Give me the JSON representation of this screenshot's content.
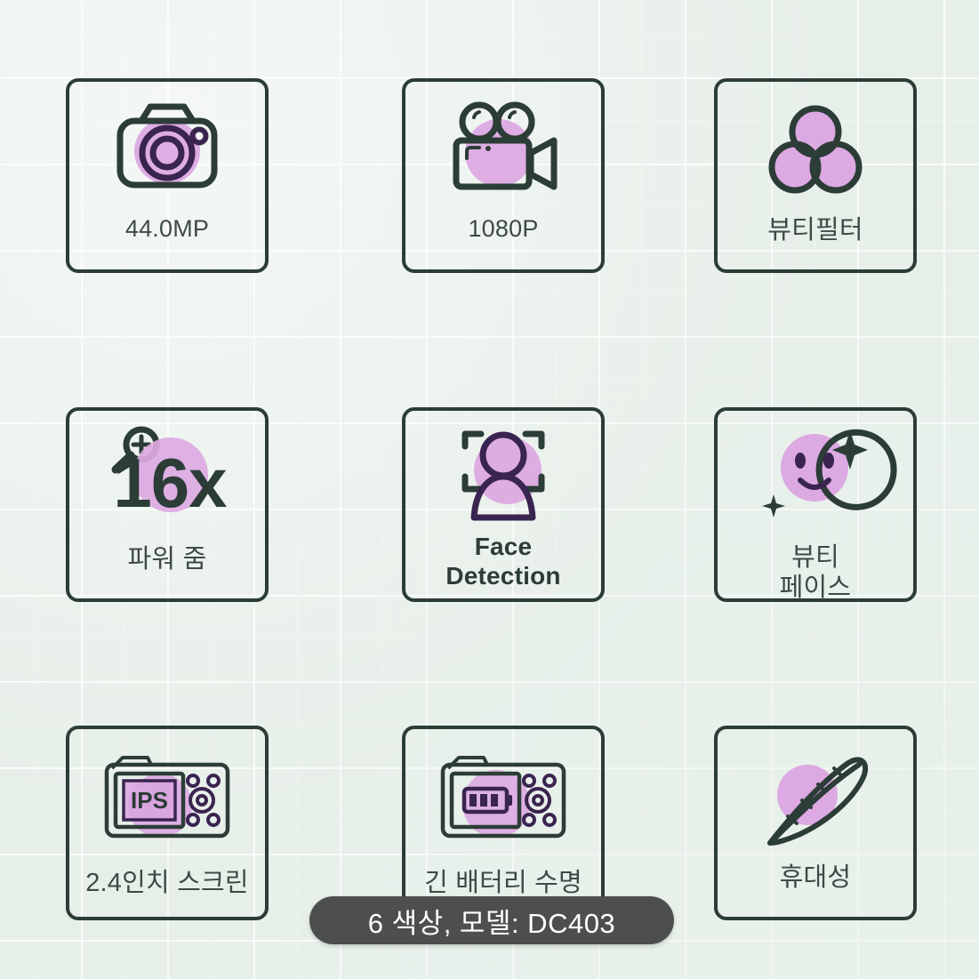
{
  "page": {
    "background_color": "#e7efe9",
    "tile_border_color": "#2c3c37",
    "accent_purple": "#dca9e2",
    "dark_purple": "#3a2450",
    "label_color": "#3d4a46"
  },
  "features": [
    {
      "id": "megapixels",
      "icon": "camera-icon",
      "label": "44.0MP"
    },
    {
      "id": "video",
      "icon": "camcorder-icon",
      "label": "1080P"
    },
    {
      "id": "beauty-filter",
      "icon": "color-circles-icon",
      "label": "뷰티필터"
    },
    {
      "id": "power-zoom",
      "icon": "magnifier-plus-icon",
      "label": "파워 줌",
      "value": "16x"
    },
    {
      "id": "face-detection",
      "icon": "face-frame-icon",
      "label": "Face\nDetection"
    },
    {
      "id": "beauty-face",
      "icon": "smiley-sparkle-icon",
      "label": "뷰티\n페이스"
    },
    {
      "id": "screen",
      "icon": "camera-back-ips-icon",
      "label": "2.4인치 스크린"
    },
    {
      "id": "battery",
      "icon": "camera-back-battery-icon",
      "label": "긴 배터리 수명"
    },
    {
      "id": "portability",
      "icon": "feather-icon",
      "label": "휴대성"
    }
  ],
  "banner": {
    "text": "6 색상, 모델: DC403",
    "background_color": "#4c4f4d",
    "text_color": "#ffffff"
  }
}
